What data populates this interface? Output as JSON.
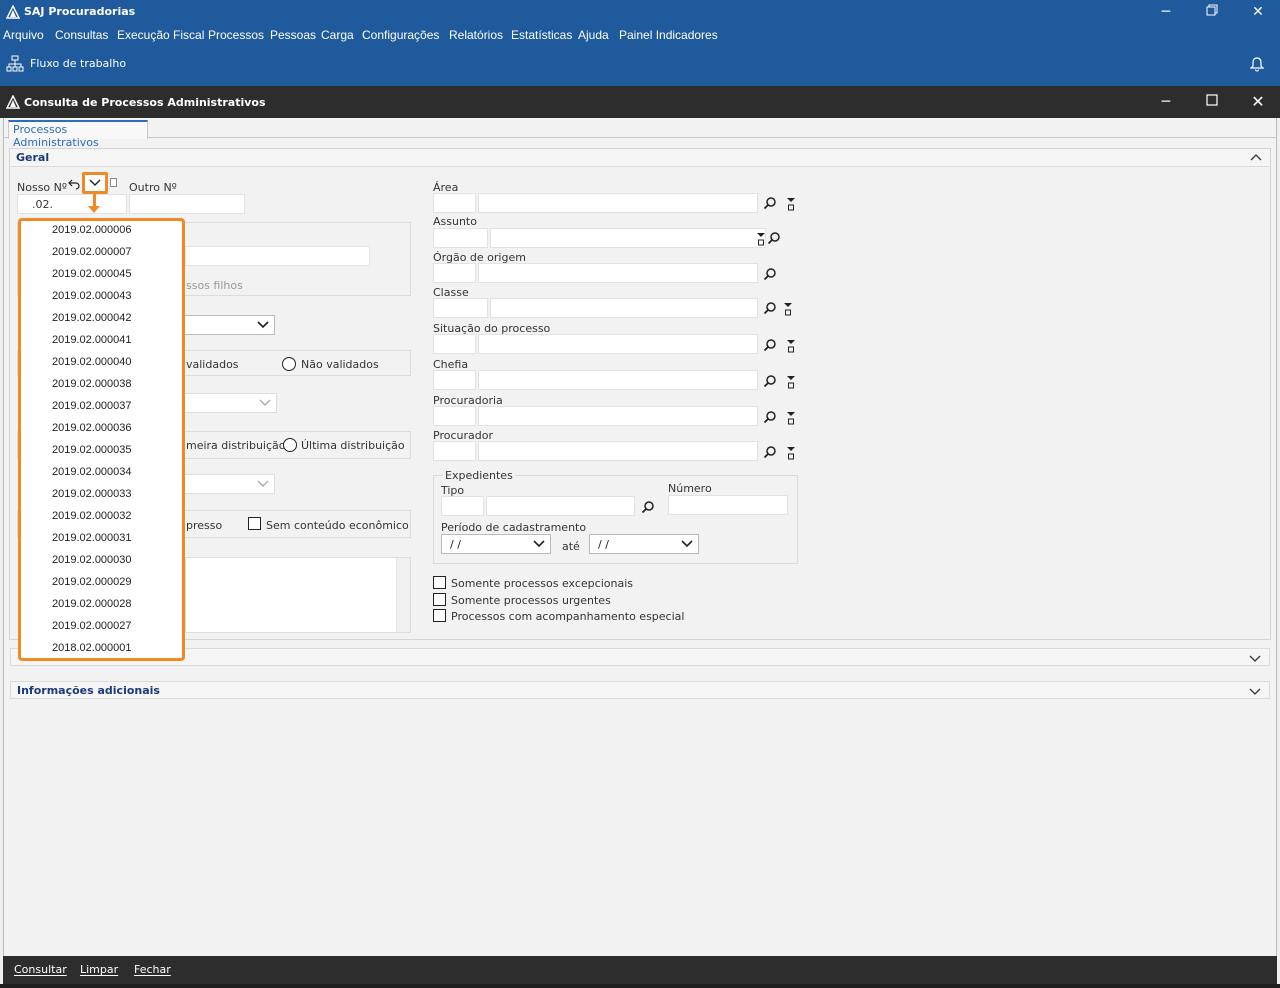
{
  "app": {
    "title": "SAJ Procuradorias",
    "menu": [
      "Arquivo",
      "Consultas",
      "Execução Fiscal",
      "Processos",
      "Pessoas",
      "Carga",
      "Configurações",
      "Relatórios",
      "Estatísticas",
      "Ajuda",
      "Painel Indicadores"
    ],
    "toolbar_label": "Fluxo de trabalho"
  },
  "window": {
    "title": "Consulta de Processos Administrativos",
    "tab": "Processos Administrativos"
  },
  "geral": {
    "title": "Geral",
    "nosso_label": "Nosso Nº",
    "nosso_value": ".02.",
    "outro_label": "Outro Nº",
    "partial_filhos": "ssos filhos",
    "partial_validados": "validados",
    "nao_validados": "Não validados",
    "partial_primeira": "meira distribuição",
    "ultima": "Última distribuição",
    "partial_expresso": "presso",
    "sem_conteudo": "Sem conteúdo econômico",
    "area": "Área",
    "assunto": "Assunto",
    "orgao": "Órgão de origem",
    "classe": "Classe",
    "situacao": "Situação do processo",
    "chefia": "Chefia",
    "procuradoria": "Procuradoria",
    "procurador": "Procurador",
    "expedientes": "Expedientes",
    "tipo": "Tipo",
    "numero": "Número",
    "periodo": "Período de cadastramento",
    "date_placeholder": " /  /",
    "ate": "até",
    "chk_excepcionais": "Somente processos excepcionais",
    "chk_urgentes": "Somente processos urgentes",
    "chk_especial": "Processos com acompanhamento especial"
  },
  "dropdown": {
    "items": [
      "2019.02.000006",
      "2019.02.000007",
      "2019.02.000045",
      "2019.02.000043",
      "2019.02.000042",
      "2019.02.000041",
      "2019.02.000040",
      "2019.02.000038",
      "2019.02.000037",
      "2019.02.000036",
      "2019.02.000035",
      "2019.02.000034",
      "2019.02.000033",
      "2019.02.000032",
      "2019.02.000031",
      "2019.02.000030",
      "2019.02.000029",
      "2019.02.000028",
      "2019.02.000027",
      "2018.02.000001"
    ]
  },
  "info": {
    "title": "Informações adicionais"
  },
  "footer": {
    "consultar": "Consultar",
    "limpar": "Limpar",
    "fechar": "Fechar"
  },
  "colors": {
    "brand": "#1e5a9c",
    "highlight": "#f08a24",
    "dark_bar": "#2d2d2d"
  }
}
